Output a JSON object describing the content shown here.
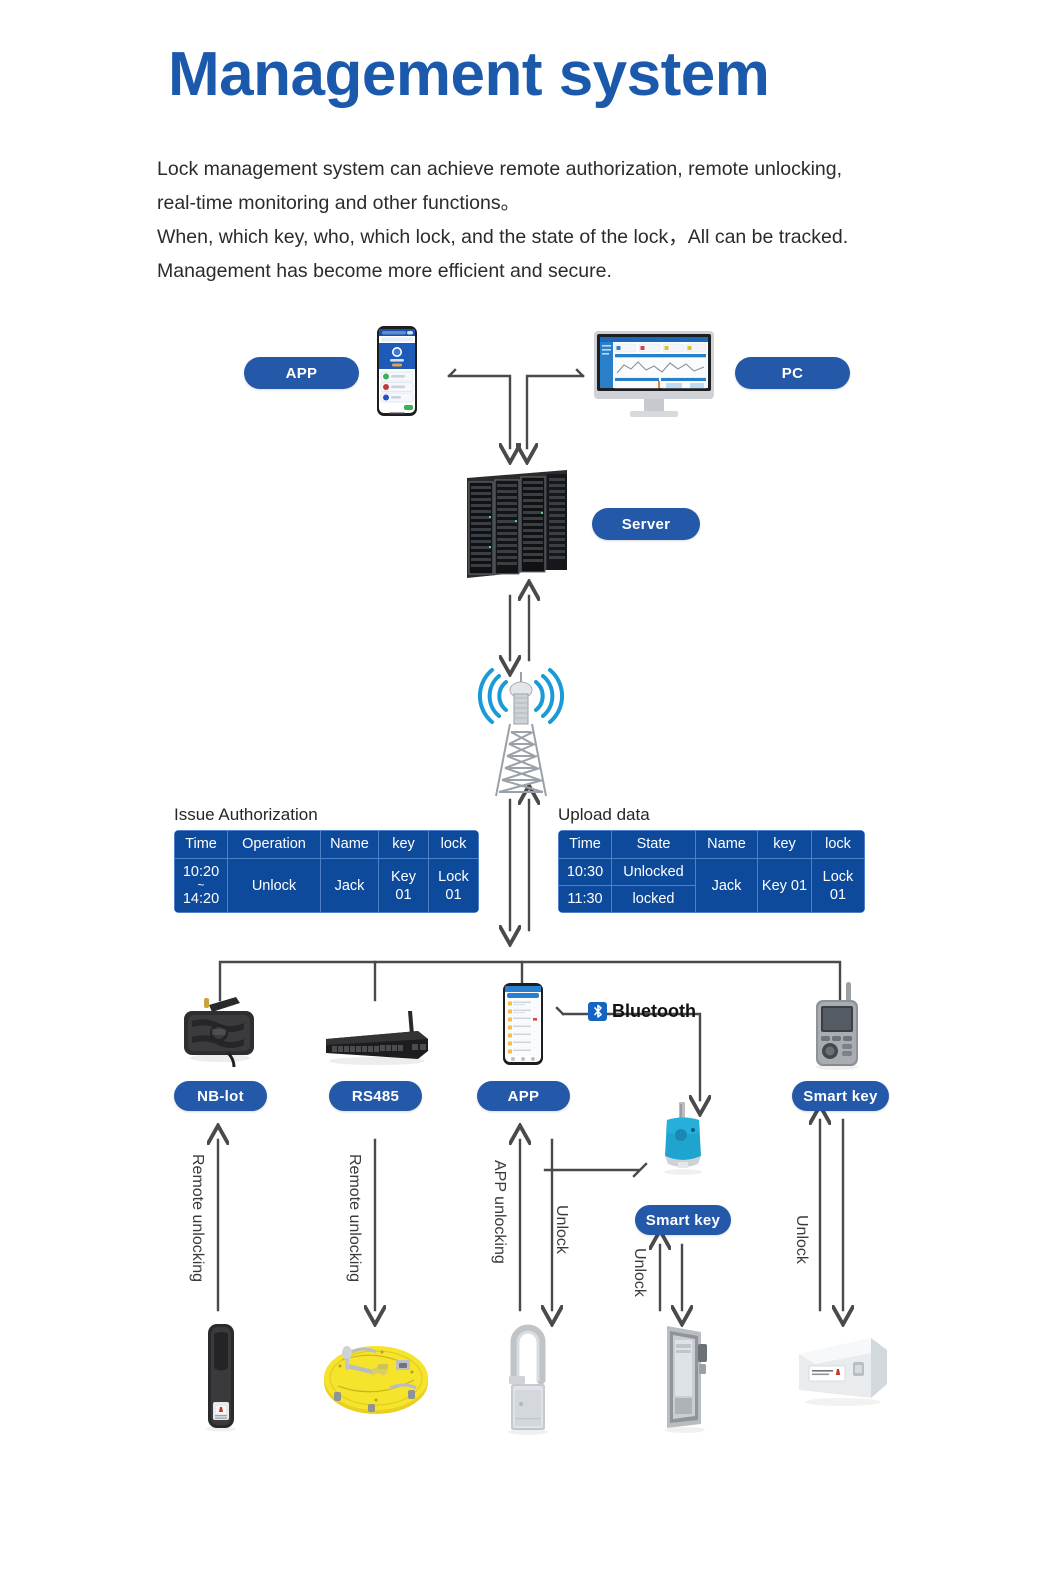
{
  "header": {
    "title": "Management system",
    "description_lines": [
      "Lock management system can achieve remote authorization, remote unlocking,",
      "real-time monitoring and other functions。",
      "When, which key, who, which lock, and the state of the lock，All can be tracked.",
      "Management has become more efficient and secure."
    ]
  },
  "colors": {
    "title_blue": "#1a59ab",
    "pill_blue": "#2458a8",
    "table_blue": "#0e4a9b",
    "table_border": "#4d80c4",
    "wire_gray": "#4a4a4a",
    "bluetooth_blue": "#1565c0",
    "signal_blue": "#1a9ad6"
  },
  "top_tier": {
    "app_label": "APP",
    "pc_label": "PC",
    "server_label": "Server"
  },
  "tables": [
    {
      "caption": "Issue Authorization",
      "headers": [
        "Time",
        "Operation",
        "Name",
        "key",
        "lock"
      ],
      "rows": [
        {
          "time_top": "10:20",
          "time_sep": "~",
          "time_bottom": "14:20",
          "operation": "Unlock",
          "name": "Jack",
          "key": "Key 01",
          "lock": "Lock 01"
        }
      ]
    },
    {
      "caption": "Upload data",
      "headers": [
        "Time",
        "State",
        "Name",
        "key",
        "lock"
      ],
      "rows": [
        {
          "time": "10:30",
          "state": "Unlocked"
        },
        {
          "time": "11:30",
          "state": "locked"
        }
      ],
      "merged": {
        "name": "Jack",
        "key": "Key 01",
        "lock": "Lock 01"
      }
    }
  ],
  "channels": [
    {
      "id": "nb-lot",
      "label": "NB-lot",
      "action": "Remote unlocking"
    },
    {
      "id": "rs485",
      "label": "RS485",
      "action": "Remote unlocking"
    },
    {
      "id": "app",
      "label": "APP",
      "action": "APP unlocking"
    },
    {
      "id": "smart-key-mid",
      "label": "Smart key",
      "action": "Unlock"
    },
    {
      "id": "smart-key-right",
      "label": "Smart key",
      "action": "Unlock"
    }
  ],
  "bluetooth": {
    "label": "Bluetooth",
    "icon": "bluetooth-icon"
  },
  "mid_links": {
    "unlock_to_key": "Unlock",
    "unlock_from_key": "Unlock"
  },
  "icons": {
    "phone": "smartphone-icon",
    "monitor": "desktop-monitor-icon",
    "server": "server-rack-icon",
    "tower": "cell-tower-icon",
    "nb_lot_device": "nb-iot-gateway-icon",
    "router": "network-switch-icon",
    "handheld": "handheld-smart-key-icon",
    "car_key": "blue-car-key-icon",
    "handle_lock": "cabinet-handle-lock-icon",
    "manhole_lock": "manhole-cover-lock-icon",
    "padlock": "smart-padlock-icon",
    "cabinet_lock": "cabinet-lock-icon",
    "box_lock": "box-lock-icon"
  }
}
